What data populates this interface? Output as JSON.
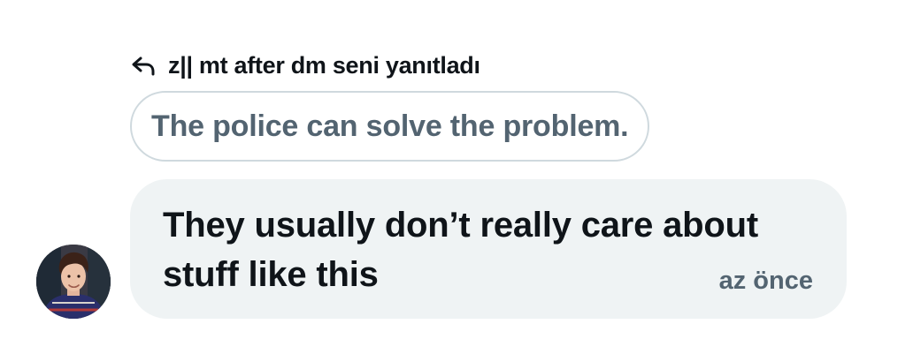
{
  "reply": {
    "icon": "reply-arrow-icon",
    "label": "z|| mt after dm seni yanıtladı"
  },
  "quoted_message": {
    "text": "The police can solve the problem."
  },
  "message": {
    "text": "They usually don’t really care about stuff like this",
    "timestamp": "az önce"
  },
  "avatar": {
    "icon": "user-avatar"
  },
  "colors": {
    "text_primary": "#0f1419",
    "text_secondary": "#536471",
    "bubble_bg": "#eff3f4",
    "quote_border": "#cfd9de"
  }
}
